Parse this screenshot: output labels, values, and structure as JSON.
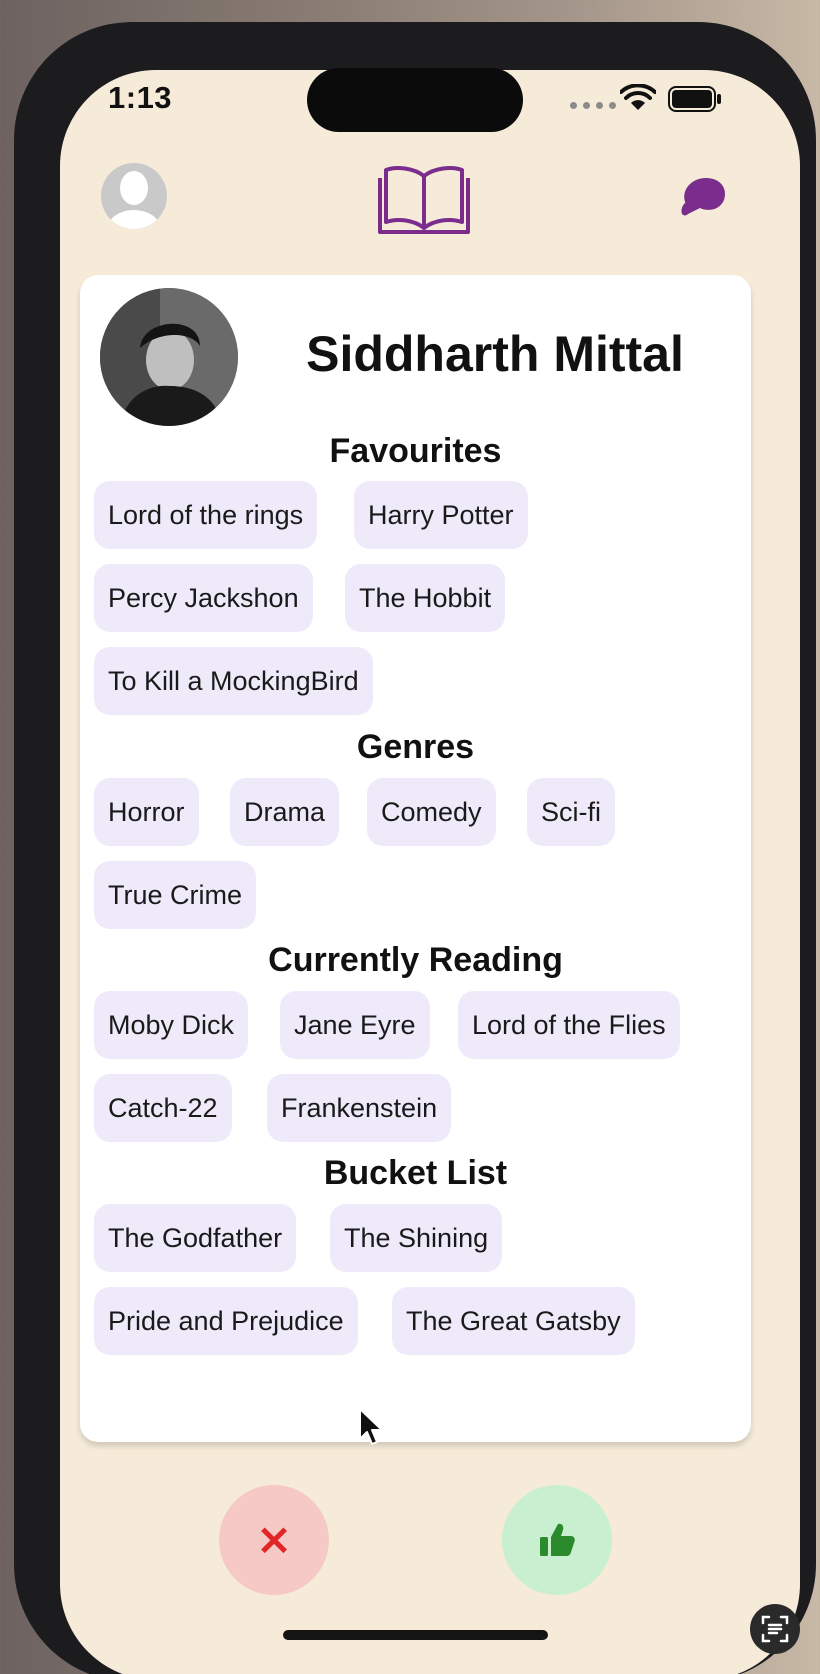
{
  "status_bar": {
    "time": "1:13"
  },
  "profile": {
    "name": "Siddharth Mittal"
  },
  "sections": {
    "favourites": {
      "title": "Favourites",
      "items": [
        "Lord of the rings",
        "Harry Potter",
        "Percy Jackshon",
        "The Hobbit",
        "To Kill a MockingBird"
      ]
    },
    "genres": {
      "title": "Genres",
      "items": [
        "Horror",
        "Drama",
        "Comedy",
        "Sci-fi",
        " True Crime"
      ]
    },
    "currently_reading": {
      "title": "Currently Reading",
      "items": [
        "Moby Dick",
        "Jane Eyre",
        "Lord of the Flies",
        "Catch-22",
        "Frankenstein"
      ]
    },
    "bucket_list": {
      "title": "Bucket List",
      "items": [
        "The Godfather",
        "The Shining",
        "Pride and Prejudice",
        "The Great Gatsby"
      ]
    }
  },
  "actions": {
    "reject_symbol": "×"
  },
  "icons": {
    "profile": "user-silhouette-icon",
    "book": "open-book-icon",
    "chat": "chat-bubbles-icon",
    "reject": "close-icon",
    "like": "thumbs-up-icon"
  },
  "colors": {
    "accent": "#7a2d8c",
    "chip_background": "#eeeafa",
    "reject_background": "#f6c9c6",
    "reject_icon": "#e02626",
    "like_background": "#c8f0d0",
    "like_icon": "#2b8a2b"
  }
}
